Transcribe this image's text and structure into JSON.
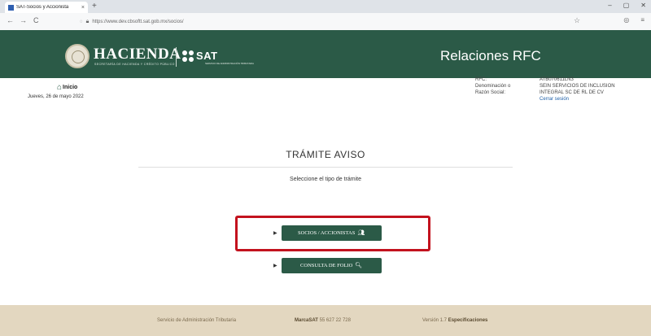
{
  "browser": {
    "tab_title": "SAT-Socios y Accionista",
    "tab_close": "×",
    "new_tab": "+",
    "url": "https://www.dev.cbsoftt.sat.gob.mx/socios/",
    "back": "←",
    "forward": "→",
    "reload": "C",
    "window_controls": [
      "–",
      "▢",
      "✕"
    ]
  },
  "header": {
    "hacienda": "HACIENDA",
    "hacienda_sub": "SECRETARÍA DE HACIENDA Y CRÉDITO PÚBLICO",
    "sat": "SAT",
    "sat_sub": "SERVICIO DE ADMINISTRACIÓN TRIBUTARIA",
    "title": "Relaciones RFC"
  },
  "info": {
    "home_label": "Inicio",
    "date": "Jueves, 26 de mayo 2022",
    "rfc_label": "RFC:",
    "rfc_value": "ATB070611LN3",
    "razon_label_1": "Denominación o",
    "razon_label_2": "Razón Social:",
    "razon_value_1": "SEIN SERVICIOS DE INCLUSION",
    "razon_value_2": "INTEGRAL SC DE RL DE CV",
    "logout": "Cerrar sesión"
  },
  "main": {
    "title": "TRÁMITE AVISO",
    "subtitle": "Seleccione el tipo de trámite",
    "btn_socios": "SOCIOS / ACCIONISTAS",
    "btn_folio": "CONSULTA DE FOLIO"
  },
  "footer": {
    "left": "Servicio de Administración Tributaria",
    "marca_label": "MarcaSAT",
    "marca_phone": "55 627 22 728",
    "version": "Versión 1.7",
    "specs": "Especificaciones"
  },
  "colors": {
    "brand_green": "#2b5a47",
    "footer_beige": "#e3d7c0",
    "highlight_red": "#c3121e",
    "link_blue": "#1d5fa8"
  }
}
